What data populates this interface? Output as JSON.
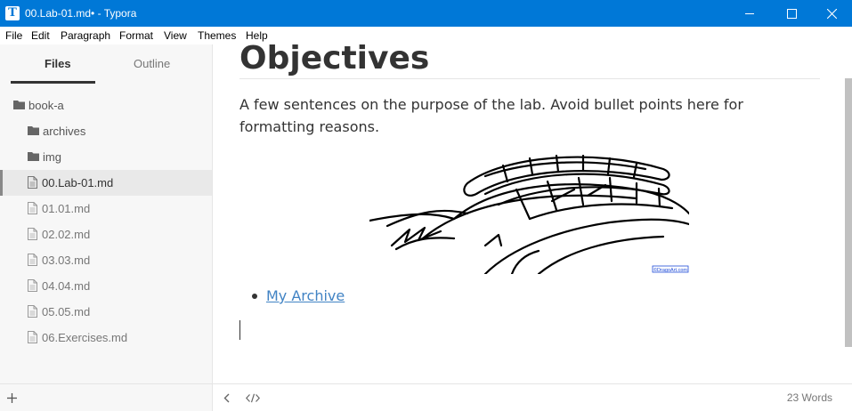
{
  "window": {
    "title": "00.Lab-01.md• - Typora",
    "app_icon_letter": "T"
  },
  "menu": [
    "File",
    "Edit",
    "Paragraph",
    "Format",
    "View",
    "Themes",
    "Help"
  ],
  "sidebar": {
    "tabs": [
      {
        "label": "Files",
        "active": true
      },
      {
        "label": "Outline",
        "active": false
      }
    ],
    "root": {
      "label": "book-a",
      "icon": "folder-icon"
    },
    "items": [
      {
        "label": "archives",
        "icon": "folder-icon",
        "active": false
      },
      {
        "label": "img",
        "icon": "folder-icon",
        "active": false
      },
      {
        "label": "00.Lab-01.md",
        "icon": "file-icon",
        "active": true
      },
      {
        "label": "01.01.md",
        "icon": "file-icon",
        "active": false
      },
      {
        "label": "02.02.md",
        "icon": "file-icon",
        "active": false
      },
      {
        "label": "03.03.md",
        "icon": "file-icon",
        "active": false
      },
      {
        "label": "04.04.md",
        "icon": "file-icon",
        "active": false
      },
      {
        "label": "05.05.md",
        "icon": "file-icon",
        "active": false
      },
      {
        "label": "06.Exercises.md",
        "icon": "file-icon",
        "active": false
      }
    ]
  },
  "editor": {
    "heading": "Objectives",
    "paragraph": "A few sentences on the purpose of the lab. Avoid bullet points here for formatting reasons.",
    "image_watermark": "©DragoArt.com",
    "list": [
      {
        "label": "My Archive"
      }
    ]
  },
  "footer": {
    "add_icon": "plus-icon",
    "toggle_sidebar_icon": "chevron-left-icon",
    "source_mode_icon": "code-icon",
    "word_count": "23 Words"
  },
  "colors": {
    "titlebar": "#0078d7",
    "link": "#4183c4",
    "sidebar_bg": "#f7f7f7"
  }
}
